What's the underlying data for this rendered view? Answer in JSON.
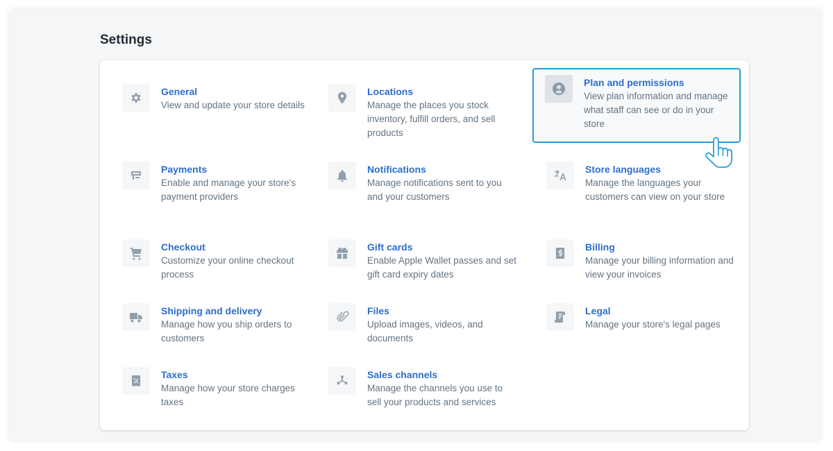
{
  "page": {
    "title": "Settings"
  },
  "settings": [
    {
      "title": "General",
      "desc": "View and update your store details",
      "icon": "gear-icon"
    },
    {
      "title": "Locations",
      "desc": "Manage the places you stock inventory, fulfill orders, and sell products",
      "icon": "location-pin-icon"
    },
    {
      "title": "Plan and permissions",
      "desc": "View plan information and manage what staff can see or do in your store",
      "icon": "user-circle-icon"
    },
    {
      "title": "Payments",
      "desc": "Enable and manage your store's payment providers",
      "icon": "payments-icon"
    },
    {
      "title": "Notifications",
      "desc": "Manage notifications sent to you and your customers",
      "icon": "bell-icon"
    },
    {
      "title": "Store languages",
      "desc": "Manage the languages your customers can view on your store",
      "icon": "translate-icon"
    },
    {
      "title": "Checkout",
      "desc": "Customize your online checkout process",
      "icon": "cart-icon"
    },
    {
      "title": "Gift cards",
      "desc": "Enable Apple Wallet passes and set gift card expiry dates",
      "icon": "gift-icon"
    },
    {
      "title": "Billing",
      "desc": "Manage your billing information and view your invoices",
      "icon": "billing-icon"
    },
    {
      "title": "Shipping and delivery",
      "desc": "Manage how you ship orders to customers",
      "icon": "truck-icon"
    },
    {
      "title": "Files",
      "desc": "Upload images, videos, and documents",
      "icon": "paperclip-icon"
    },
    {
      "title": "Legal",
      "desc": "Manage your store's legal pages",
      "icon": "legal-document-icon"
    },
    {
      "title": "Taxes",
      "desc": "Manage how your store charges taxes",
      "icon": "tax-receipt-icon"
    },
    {
      "title": "Sales channels",
      "desc": "Manage the channels you use to sell your products and services",
      "icon": "sales-channels-icon"
    }
  ],
  "colors": {
    "link": "#2c6ecb",
    "highlight_border": "#2a9bd8",
    "icon": "#919eab"
  }
}
